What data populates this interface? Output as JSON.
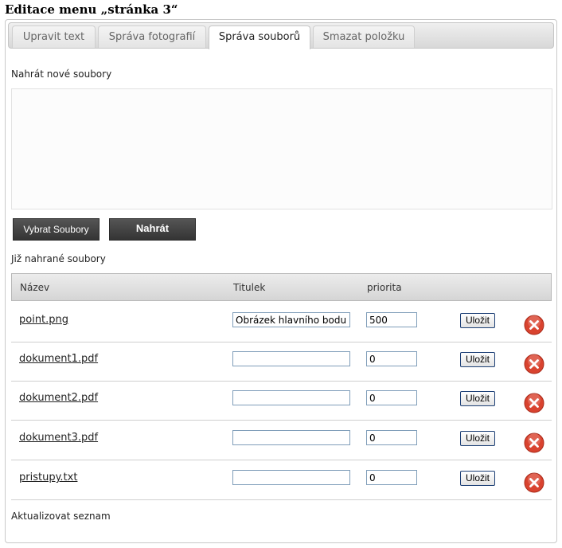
{
  "page_title": "Editace menu „stránka 3“",
  "tabs": [
    {
      "label": "Upravit text",
      "active": false
    },
    {
      "label": "Správa fotografií",
      "active": false
    },
    {
      "label": "Správa souborů",
      "active": true
    },
    {
      "label": "Smazat položku",
      "active": false
    }
  ],
  "upload": {
    "heading": "Nahrát nové soubory",
    "select_button": "Vybrat Soubory",
    "upload_button": "Nahrát"
  },
  "files": {
    "heading": "Již nahrané soubory",
    "columns": {
      "name": "Název",
      "title": "Titulek",
      "priority": "priorita"
    },
    "rows": [
      {
        "name": "point.png",
        "title": "Obrázek hlavního bodu",
        "priority": "500",
        "save": "Uložit"
      },
      {
        "name": "dokument1.pdf",
        "title": "",
        "priority": "0",
        "save": "Uložit"
      },
      {
        "name": "dokument2.pdf",
        "title": "",
        "priority": "0",
        "save": "Uložit"
      },
      {
        "name": "dokument3.pdf",
        "title": "",
        "priority": "0",
        "save": "Uložit"
      },
      {
        "name": "pristupy.txt",
        "title": "",
        "priority": "0",
        "save": "Uložit"
      }
    ]
  },
  "update_link": "Aktualizovat seznam",
  "colors": {
    "delete_icon": "#d9432f"
  },
  "icons": {
    "delete": "delete-icon"
  }
}
